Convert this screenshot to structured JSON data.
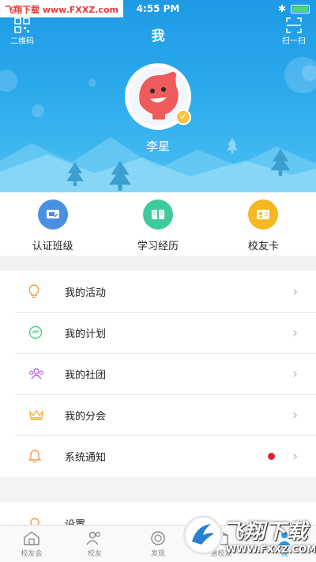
{
  "status_bar": {
    "watermark": "飞翔下载 www.FXXZ.com",
    "time": "4:55 PM"
  },
  "header": {
    "title": "我",
    "qr_label": "二维码",
    "scan_label": "扫一扫",
    "username": "李星"
  },
  "quick_actions": [
    {
      "label": "认证班级",
      "icon": "certified-class-icon",
      "color": "#4a90e2"
    },
    {
      "label": "学习经历",
      "icon": "book-icon",
      "color": "#3ecb9a"
    },
    {
      "label": "校友卡",
      "icon": "card-icon",
      "color": "#f5b823"
    }
  ],
  "menu": [
    {
      "label": "我的活动",
      "icon": "lightbulb-icon",
      "color": "#f29a4a"
    },
    {
      "label": "我的计划",
      "icon": "plan-check-icon",
      "color": "#4ccf8a"
    },
    {
      "label": "我的社团",
      "icon": "group-icon",
      "color": "#b56fe0"
    },
    {
      "label": "我的分会",
      "icon": "crown-icon",
      "color": "#f1b23a"
    },
    {
      "label": "系统通知",
      "icon": "bell-icon",
      "color": "#f29a4a",
      "unread": true
    }
  ],
  "menu2": [
    {
      "label": "设置",
      "icon": "settings-icon"
    }
  ],
  "tabbar": [
    {
      "label": "校友会",
      "icon": "alumni-house-icon"
    },
    {
      "label": "校友",
      "icon": "people-icon"
    },
    {
      "label": "发现",
      "icon": "discover-icon"
    },
    {
      "label": "惠校友",
      "icon": "benefit-icon"
    },
    {
      "label": "我",
      "icon": "me-icon",
      "active": true
    }
  ],
  "brand_overlay": {
    "title": "飞翔下载",
    "url": "WWW.FXXZ.COM"
  },
  "colors": {
    "header_blue": "#2aa9ec",
    "accent": "#2a9de8",
    "badge_red": "#e5202e"
  }
}
